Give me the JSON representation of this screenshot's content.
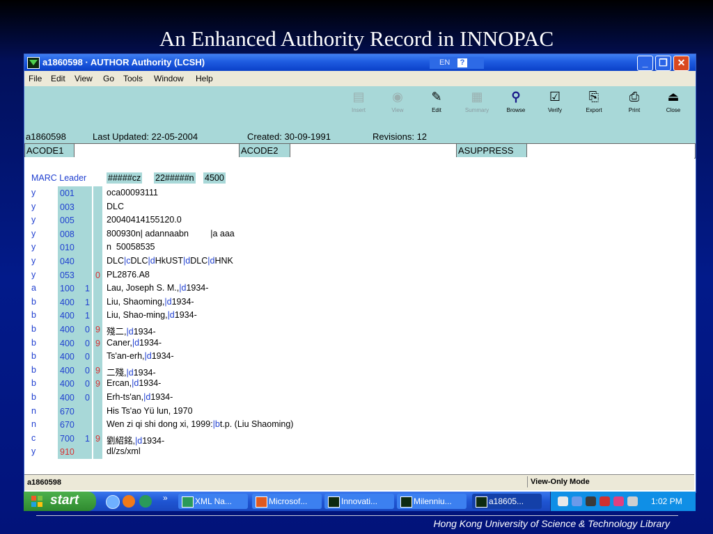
{
  "slide": {
    "title": "An Enhanced Authority Record in INNOPAC",
    "footer": "Hong Kong University of Science & Technology Library"
  },
  "window": {
    "title": "a1860598 · AUTHOR Authority (LCSH)",
    "lang": "EN",
    "menu": [
      "File",
      "Edit",
      "View",
      "Go",
      "Tools",
      "Window",
      "Help"
    ],
    "toolbar": [
      {
        "label": "Insert",
        "icon": "insert-icon",
        "enabled": false
      },
      {
        "label": "View",
        "icon": "view-icon",
        "enabled": false
      },
      {
        "label": "Edit",
        "icon": "edit-icon",
        "enabled": true
      },
      {
        "label": "Summary",
        "icon": "summary-icon",
        "enabled": false
      },
      {
        "label": "Browse",
        "icon": "magnifier-icon",
        "enabled": true
      },
      {
        "label": "Verify",
        "icon": "checklist-icon",
        "enabled": true
      },
      {
        "label": "Export",
        "icon": "export-icon",
        "enabled": true
      },
      {
        "label": "Print",
        "icon": "printer-icon",
        "enabled": true
      },
      {
        "label": "Close",
        "icon": "close-tray-icon",
        "enabled": true
      }
    ]
  },
  "info": {
    "record_id": "a1860598",
    "last_updated": "Last Updated: 22-05-2004",
    "created": "Created: 30-09-1991",
    "revisions": "Revisions: 12"
  },
  "codes": {
    "acode1": "ACODE1",
    "acode1_value": "",
    "acode2": "ACODE2",
    "acode2_value": "",
    "asuppress": "ASUPPRESS",
    "asuppress_value": ""
  },
  "marc": {
    "leader_label": "MARC Leader",
    "leader_parts": [
      "#####cz",
      "22#####n",
      "4500"
    ],
    "rows": [
      {
        "ind": "y",
        "tag": "001",
        "i1": "",
        "i2": "",
        "data": [
          [
            "t",
            "oca00093111"
          ]
        ]
      },
      {
        "ind": "y",
        "tag": "003",
        "i1": "",
        "i2": "",
        "data": [
          [
            "t",
            "DLC"
          ]
        ]
      },
      {
        "ind": "y",
        "tag": "005",
        "i1": "",
        "i2": "",
        "data": [
          [
            "t",
            "20040414155120.0"
          ]
        ]
      },
      {
        "ind": "y",
        "tag": "008",
        "i1": "",
        "i2": "",
        "data": [
          [
            "t",
            "800930n| adannaabn         |a aaa"
          ]
        ]
      },
      {
        "ind": "y",
        "tag": "010",
        "i1": "",
        "i2": "",
        "data": [
          [
            "t",
            "n  50058535"
          ]
        ]
      },
      {
        "ind": "y",
        "tag": "040",
        "i1": "",
        "i2": "",
        "data": [
          [
            "t",
            "DLC"
          ],
          [
            "s",
            "|c"
          ],
          [
            "t",
            "DLC"
          ],
          [
            "s",
            "|d"
          ],
          [
            "t",
            "HkUST"
          ],
          [
            "s",
            "|d"
          ],
          [
            "t",
            "DLC"
          ],
          [
            "s",
            "|d"
          ],
          [
            "t",
            "HNK"
          ]
        ]
      },
      {
        "ind": "y",
        "tag": "053",
        "i1": "",
        "i2": "0",
        "data": [
          [
            "t",
            "PL2876.A8"
          ]
        ]
      },
      {
        "ind": "a",
        "tag": "100",
        "i1": "1",
        "i2": "",
        "data": [
          [
            "t",
            "Lau, Joseph S. M.,"
          ],
          [
            "s",
            "|d"
          ],
          [
            "t",
            "1934-"
          ]
        ]
      },
      {
        "ind": "b",
        "tag": "400",
        "i1": "1",
        "i2": "",
        "data": [
          [
            "t",
            "Liu, Shaoming,"
          ],
          [
            "s",
            "|d"
          ],
          [
            "t",
            "1934-"
          ]
        ]
      },
      {
        "ind": "b",
        "tag": "400",
        "i1": "1",
        "i2": "",
        "data": [
          [
            "t",
            "Liu, Shao-ming,"
          ],
          [
            "s",
            "|d"
          ],
          [
            "t",
            "1934-"
          ]
        ]
      },
      {
        "ind": "b",
        "tag": "400",
        "i1": "0",
        "i2": "9",
        "data": [
          [
            "t",
            "殘二,"
          ],
          [
            "s",
            "|d"
          ],
          [
            "t",
            "1934-"
          ]
        ]
      },
      {
        "ind": "b",
        "tag": "400",
        "i1": "0",
        "i2": "9",
        "data": [
          [
            "t",
            "Caner,"
          ],
          [
            "s",
            "|d"
          ],
          [
            "t",
            "1934-"
          ]
        ]
      },
      {
        "ind": "b",
        "tag": "400",
        "i1": "0",
        "i2": "",
        "data": [
          [
            "t",
            "Ts'an-erh,"
          ],
          [
            "s",
            "|d"
          ],
          [
            "t",
            "1934-"
          ]
        ]
      },
      {
        "ind": "b",
        "tag": "400",
        "i1": "0",
        "i2": "9",
        "data": [
          [
            "t",
            "二殘,"
          ],
          [
            "s",
            "|d"
          ],
          [
            "t",
            "1934-"
          ]
        ]
      },
      {
        "ind": "b",
        "tag": "400",
        "i1": "0",
        "i2": "9",
        "data": [
          [
            "t",
            "Ercan,"
          ],
          [
            "s",
            "|d"
          ],
          [
            "t",
            "1934-"
          ]
        ]
      },
      {
        "ind": "b",
        "tag": "400",
        "i1": "0",
        "i2": "",
        "data": [
          [
            "t",
            "Erh-ts'an,"
          ],
          [
            "s",
            "|d"
          ],
          [
            "t",
            "1934-"
          ]
        ]
      },
      {
        "ind": "n",
        "tag": "670",
        "i1": "",
        "i2": "",
        "data": [
          [
            "t",
            "His Ts'ao Yü lun, 1970"
          ]
        ]
      },
      {
        "ind": "n",
        "tag": "670",
        "i1": "",
        "i2": "",
        "data": [
          [
            "t",
            "Wen zi qi shi dong xi, 1999:"
          ],
          [
            "s",
            "|b"
          ],
          [
            "t",
            "t.p. (Liu Shaoming)"
          ]
        ]
      },
      {
        "ind": "c",
        "tag": "700",
        "i1": "1",
        "i2": "9",
        "data": [
          [
            "t",
            "劉紹銘,"
          ],
          [
            "s",
            "|d"
          ],
          [
            "t",
            "1934-"
          ]
        ]
      },
      {
        "ind": "y",
        "tag": "910",
        "tag_red": true,
        "i1": "",
        "i2": "",
        "data": [
          [
            "t",
            "dl/zs/xml"
          ]
        ]
      }
    ]
  },
  "status": {
    "left": "a1860598",
    "right": "View-Only Mode"
  },
  "taskbar": {
    "start": "start",
    "tasks": [
      {
        "label": "XML Na...",
        "color": "#2a9a5a"
      },
      {
        "label": "Microsof...",
        "color": "#e05a20"
      },
      {
        "label": "Innovati...",
        "color": "#0d2a10"
      },
      {
        "label": "Milenniu...",
        "color": "#0d2a10"
      },
      {
        "label": "a18605...",
        "color": "#0d2a10",
        "active": true
      }
    ],
    "clock": "1:02 PM"
  }
}
